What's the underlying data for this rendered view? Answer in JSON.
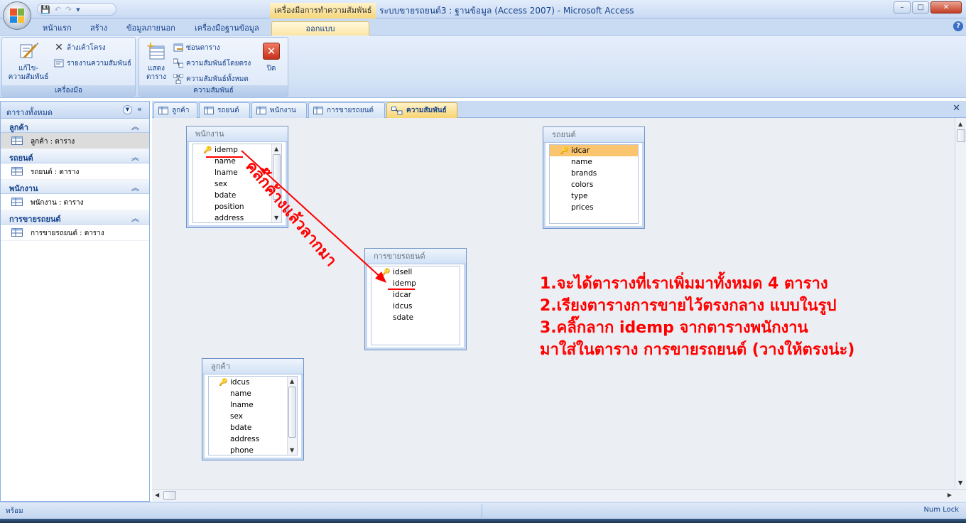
{
  "window": {
    "context_title": "เครื่องมือการทำความสัมพันธ์",
    "title": "ระบบขายรถยนต์3 : ฐานข้อมูล (Access 2007) - Microsoft Access",
    "minimize": "–",
    "maximize": "□",
    "close": "✕"
  },
  "ribbon_tabs": [
    "หน้าแรก",
    "สร้าง",
    "ข้อมูลภายนอก",
    "เครื่องมือฐานข้อมูล",
    "ออกแบบ"
  ],
  "help": "?",
  "ribbon": {
    "tools_group": {
      "label": "เครื่องมือ",
      "edit_relationships": "แก้ไข-\nความสัมพันธ์",
      "clear_layout": "ล้างเค้าโครง",
      "relationship_report": "รายงานความสัมพันธ์"
    },
    "relationships_group": {
      "label": "ความสัมพันธ์",
      "show_table": "แสดง\nตาราง",
      "hide_table": "ซ่อนตาราง",
      "direct_relationships": "ความสัมพันธ์โดยตรง",
      "all_relationships": "ความสัมพันธ์ทั้งหมด",
      "close": "ปิด"
    }
  },
  "nav": {
    "title": "ตารางทั้งหมด",
    "groups": [
      {
        "name": "ลูกค้า",
        "item": "ลูกค้า : ตาราง"
      },
      {
        "name": "รถยนต์",
        "item": "รถยนต์ : ตาราง"
      },
      {
        "name": "พนักงาน",
        "item": "พนักงาน : ตาราง"
      },
      {
        "name": "การขายรถยนต์",
        "item": "การขายรถยนต์ : ตาราง"
      }
    ]
  },
  "doc_tabs": [
    "ลูกค้า",
    "รถยนต์",
    "พนักงาน",
    "การขายรถยนต์",
    "ความสัมพันธ์"
  ],
  "tables": {
    "employee": {
      "title": "พนักงาน",
      "fields": [
        "idemp",
        "name",
        "lname",
        "sex",
        "bdate",
        "position",
        "address"
      ]
    },
    "car": {
      "title": "รถยนต์",
      "fields": [
        "idcar",
        "name",
        "brands",
        "colors",
        "type",
        "prices"
      ]
    },
    "sales": {
      "title": "การขายรถยนต์",
      "fields": [
        "idsell",
        "idemp",
        "idcar",
        "idcus",
        "sdate"
      ]
    },
    "customer": {
      "title": "ลูกค้า",
      "fields": [
        "idcus",
        "name",
        "lname",
        "sex",
        "bdate",
        "address",
        "phone"
      ]
    }
  },
  "annotation": {
    "drag_hint": "คลิ๊กค้างแล้วลากมา",
    "lines": [
      "1.จะได้ตารางที่เราเพิ่มมาทั้งหมด 4 ตาราง",
      "2.เรียงตารางการขายไว้ตรงกลาง แบบในรูป",
      "3.คลิ๊กลาก idemp จากตารางพนักงาน",
      "มาใส่ในตาราง การขายรถยนต์ (วางให้ตรงน่ะ)"
    ]
  },
  "status": {
    "left": "พร้อม",
    "right": "Num Lock"
  },
  "colors": {
    "accent": "#15428b",
    "highlight": "#fbc46f",
    "annotation": "#ff0000",
    "context_tab": "#f8d471"
  }
}
